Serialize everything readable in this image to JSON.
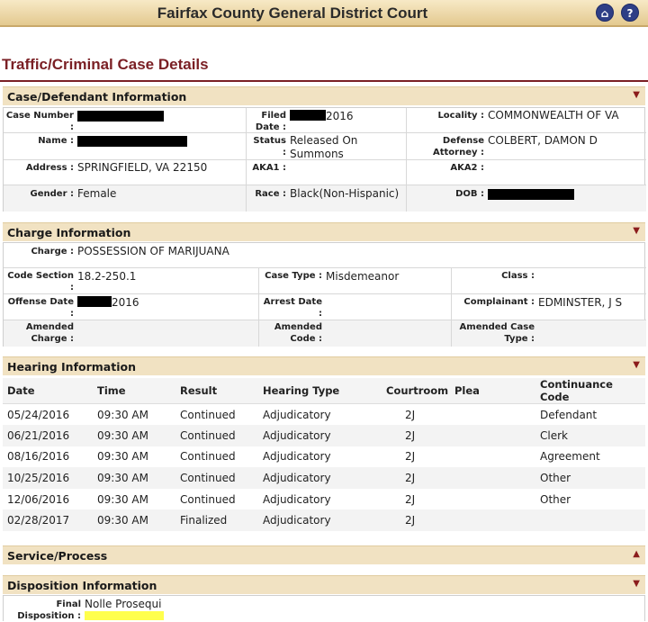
{
  "header": {
    "title": "Fairfax County General District Court",
    "home_icon": "home-icon",
    "help_icon": "help-icon",
    "home_glyph": "⌂",
    "help_glyph": "?"
  },
  "page_title": "Traffic/Criminal Case Details",
  "case_section": {
    "title": "Case/Defendant Information",
    "case_number_label": "Case Number :",
    "filed_date_label": "Filed Date :",
    "filed_date_suffix": "2016",
    "locality_label": "Locality :",
    "locality_value": "COMMONWEALTH OF VA",
    "name_label": "Name :",
    "status_label": "Status :",
    "status_value": "Released On Summons",
    "defense_attorney_label": "Defense Attorney :",
    "defense_attorney_value": "COLBERT, DAMON D",
    "address_label": "Address :",
    "address_value": "SPRINGFIELD, VA 22150",
    "aka1_label": "AKA1 :",
    "aka2_label": "AKA2 :",
    "gender_label": "Gender :",
    "gender_value": "Female",
    "race_label": "Race :",
    "race_value": "Black(Non-Hispanic)",
    "dob_label": "DOB :"
  },
  "charge_section": {
    "title": "Charge Information",
    "charge_label": "Charge :",
    "charge_value": "POSSESSION OF MARIJUANA",
    "code_section_label": "Code Section :",
    "code_section_value": "18.2-250.1",
    "case_type_label": "Case Type :",
    "case_type_value": "Misdemeanor",
    "class_label": "Class :",
    "offense_date_label": "Offense Date :",
    "offense_date_suffix": "2016",
    "arrest_date_label": "Arrest Date :",
    "complainant_label": "Complainant :",
    "complainant_value": "EDMINSTER, J S",
    "amended_charge_label": "Amended Charge :",
    "amended_code_label": "Amended Code :",
    "amended_case_type_label": "Amended Case Type :"
  },
  "hearing_section": {
    "title": "Hearing Information",
    "columns": [
      "Date",
      "Time",
      "Result",
      "Hearing Type",
      "Courtroom",
      "Plea",
      "Continuance Code"
    ],
    "rows": [
      [
        "05/24/2016",
        "09:30 AM",
        "Continued",
        "Adjudicatory",
        "2J",
        "",
        "Defendant"
      ],
      [
        "06/21/2016",
        "09:30 AM",
        "Continued",
        "Adjudicatory",
        "2J",
        "",
        "Clerk"
      ],
      [
        "08/16/2016",
        "09:30 AM",
        "Continued",
        "Adjudicatory",
        "2J",
        "",
        "Agreement"
      ],
      [
        "10/25/2016",
        "09:30 AM",
        "Continued",
        "Adjudicatory",
        "2J",
        "",
        "Other"
      ],
      [
        "12/06/2016",
        "09:30 AM",
        "Continued",
        "Adjudicatory",
        "2J",
        "",
        "Other"
      ],
      [
        "02/28/2017",
        "09:30 AM",
        "Finalized",
        "Adjudicatory",
        "2J",
        "",
        ""
      ]
    ]
  },
  "service_section": {
    "title": "Service/Process"
  },
  "disposition_section": {
    "title": "Disposition Information",
    "final_disposition_label": "Final Disposition :",
    "final_disposition_value": "Nolle Prosequi"
  },
  "colors": {
    "accent": "#7a1f24",
    "header_bg": "#f1e2c2",
    "highlight": "#ffff4d",
    "icon_blue": "#2e3e86"
  }
}
